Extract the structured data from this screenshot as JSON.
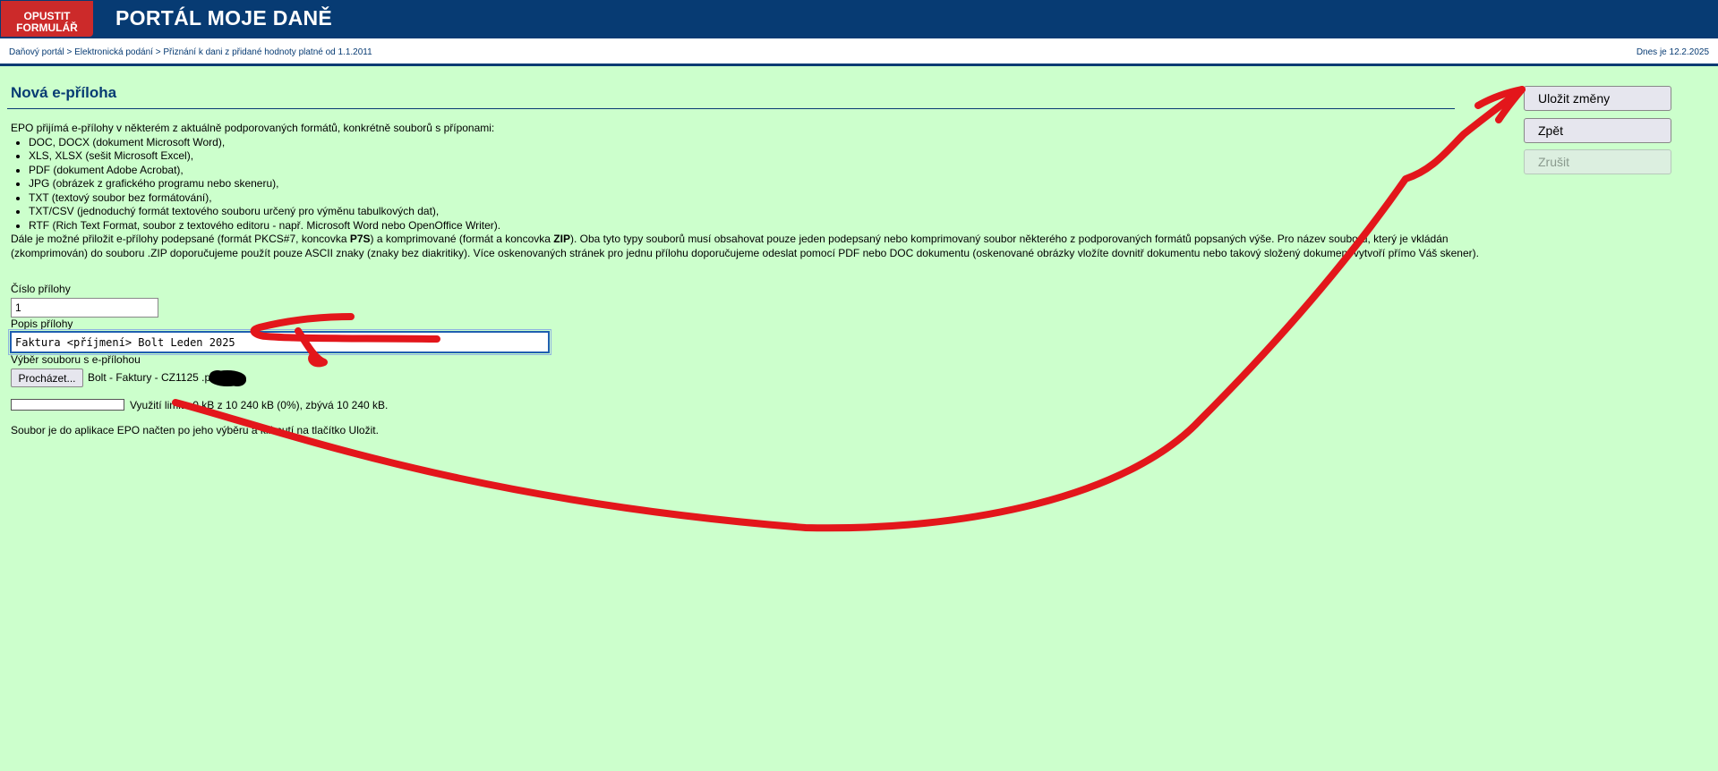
{
  "header": {
    "exit_line1": "OPUSTIT",
    "exit_line2": "FORMULÁŘ",
    "portal_title": "PORTÁL MOJE DANĚ"
  },
  "breadcrumb": {
    "items": [
      "Daňový portál",
      "Elektronická podání",
      "Přiznání k dani z přidané hodnoty platné od 1.1.2011"
    ],
    "separator": ">"
  },
  "date_text": "Dnes je 12.2.2025",
  "page": {
    "heading": "Nová e-příloha"
  },
  "side_buttons": {
    "save": "Uložit změny",
    "back": "Zpět",
    "cancel": "Zrušit"
  },
  "info": {
    "intro": "EPO přijímá e-přílohy v některém z aktuálně podporovaných formátů, konkrétně souborů s příponami:",
    "formats": [
      "DOC, DOCX (dokument Microsoft Word),",
      "XLS, XLSX (sešit Microsoft Excel),",
      "PDF (dokument Adobe Acrobat),",
      "JPG (obrázek z grafického programu nebo skeneru),",
      "TXT (textový soubor bez formátování),",
      "TXT/CSV (jednoduchý formát textového souboru určený pro výměnu tabulkových dat),",
      "RTF (Rich Text Format, soubor z textového editoru - např. Microsoft Word nebo OpenOffice Writer)."
    ],
    "more_part1": "Dále je možné přiložit e-přílohy podepsané (formát PKCS#7, koncovka ",
    "more_bold1": "P7S",
    "more_part2": ") a komprimované (formát a koncovka ",
    "more_bold2": "ZIP",
    "more_part3": "). Oba tyto typy souborů musí obsahovat pouze jeden podepsaný nebo komprimovaný soubor některého z podporovaných formátů popsaných výše. Pro název souboru, který je vkládán (zkomprimován) do souboru .ZIP doporučujeme použít pouze ASCII znaky (znaky bez diakritiky). Více oskenovaných stránek pro jednu přílohu doporučujeme odeslat pomocí PDF nebo DOC dokumentu (oskenované obrázky vložíte dovnitř dokumentu nebo takový složený dokument vytvoří přímo Váš skener)."
  },
  "form": {
    "number_label": "Číslo přílohy",
    "number_value": "1",
    "desc_label": "Popis přílohy",
    "desc_value": "Faktura <příjmení> Bolt Leden 2025",
    "file_label": "Výběr souboru s e-přílohou",
    "browse_button": "Procházet...",
    "file_name": "Bolt - Faktury - CZ1125          .pdf",
    "usage_fraction": 0,
    "usage_text": "Využití limitu 0 kB z 10 240 kB (0%), zbývá 10 240 kB.",
    "note": "Soubor je do aplikace EPO načten po jeho výběru a kliknutí na tlačítko Uložit."
  },
  "colors": {
    "header_bg": "#073b73",
    "exit_button": "#cc2a2a",
    "page_bg": "#ccffcc",
    "annotation": "#e3161b"
  }
}
